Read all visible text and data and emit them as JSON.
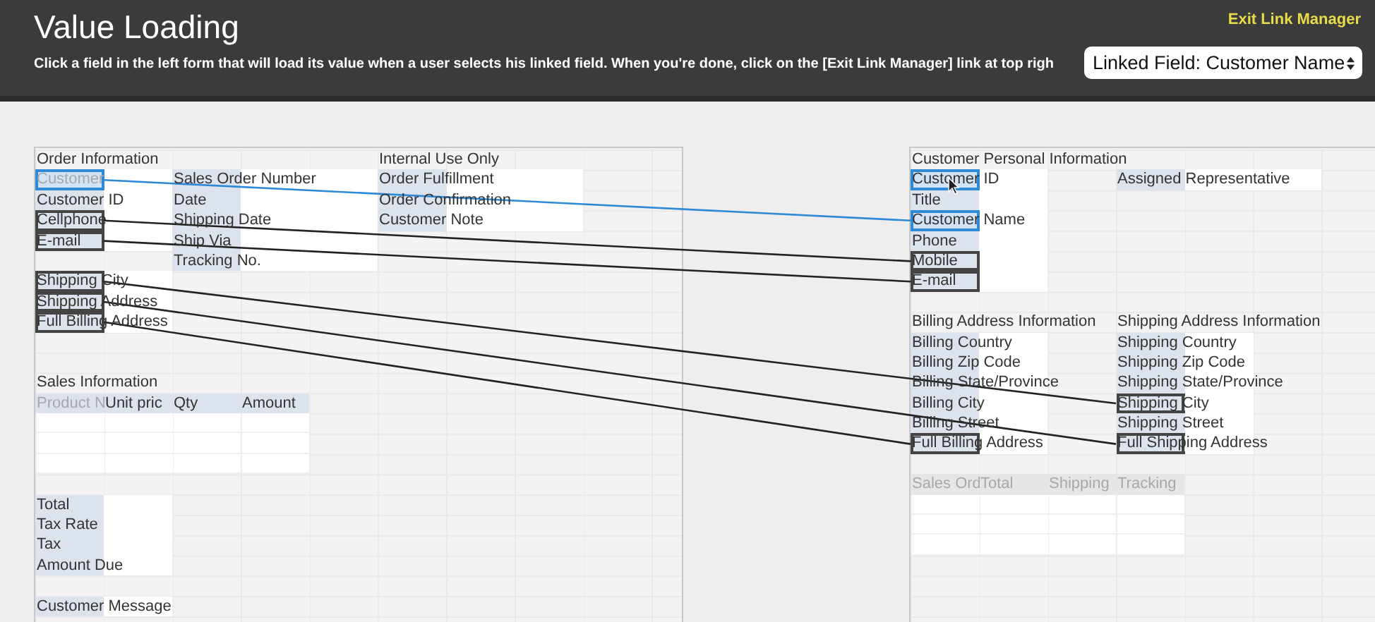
{
  "header": {
    "title": "Value Loading",
    "instructions": "Click a field in the left form that will load its value when a user selects his linked field. When you're done, click on the [Exit Link Manager] link at top righ",
    "exit_link": "Exit Link Manager",
    "linked_field_select": {
      "value": "Linked Field: Customer Name"
    }
  },
  "panels": [
    {
      "cells": [
        {
          "kind": "heading",
          "label": "Order Information"
        },
        {
          "kind": "heading",
          "label": "Internal Use Only"
        },
        {
          "kind": "field",
          "label": "Customer",
          "linked": true,
          "highlighted": true,
          "disabled": true
        },
        {
          "kind": "field",
          "label": "Sales Order Number",
          "linked": false,
          "highlighted": false,
          "disabled": false
        },
        {
          "kind": "field",
          "label": "Order Fulfillment",
          "linked": false,
          "highlighted": false,
          "disabled": false
        },
        {
          "kind": "field",
          "label": "Customer ID",
          "linked": false,
          "highlighted": false,
          "disabled": false
        },
        {
          "kind": "field",
          "label": "Date",
          "linked": false,
          "highlighted": false,
          "disabled": false
        },
        {
          "kind": "field",
          "label": "Order Confirmation",
          "linked": false,
          "highlighted": false,
          "disabled": false
        },
        {
          "kind": "field",
          "label": "Cellphone",
          "linked": true,
          "highlighted": false,
          "disabled": false
        },
        {
          "kind": "field",
          "label": "Shipping Date",
          "linked": false,
          "highlighted": false,
          "disabled": false
        },
        {
          "kind": "field",
          "label": "Customer Note",
          "linked": false,
          "highlighted": false,
          "disabled": false
        },
        {
          "kind": "field",
          "label": "E-mail",
          "linked": true,
          "highlighted": false,
          "disabled": false
        },
        {
          "kind": "field",
          "label": "Ship Via",
          "linked": false,
          "highlighted": false,
          "disabled": false
        },
        {
          "kind": "field",
          "label": "Tracking No.",
          "linked": false,
          "highlighted": false,
          "disabled": false
        },
        {
          "kind": "field",
          "label": "Shipping City",
          "linked": true,
          "highlighted": false,
          "disabled": false
        },
        {
          "kind": "field",
          "label": "Shipping Address",
          "linked": true,
          "highlighted": false,
          "disabled": false
        },
        {
          "kind": "field",
          "label": "Full Billing Address",
          "linked": true,
          "highlighted": false,
          "disabled": false
        },
        {
          "kind": "heading",
          "label": "Sales Information"
        },
        {
          "kind": "column_header",
          "label": "Product N",
          "disabled": true
        },
        {
          "kind": "column_header",
          "label": "Unit pric",
          "disabled": false
        },
        {
          "kind": "column_header",
          "label": "Qty",
          "disabled": false
        },
        {
          "kind": "column_header",
          "label": "Amount",
          "disabled": false
        },
        {
          "kind": "field",
          "label": "Total",
          "linked": false,
          "highlighted": false,
          "disabled": false
        },
        {
          "kind": "field",
          "label": "Tax Rate",
          "linked": false,
          "highlighted": false,
          "disabled": false
        },
        {
          "kind": "field",
          "label": "Tax",
          "linked": false,
          "highlighted": false,
          "disabled": false
        },
        {
          "kind": "field",
          "label": "Amount Due",
          "linked": false,
          "highlighted": false,
          "disabled": false
        },
        {
          "kind": "field",
          "label": "Customer Message",
          "linked": false,
          "highlighted": false,
          "disabled": false
        }
      ]
    },
    {
      "cells": [
        {
          "kind": "heading",
          "label": "Customer Personal Information"
        },
        {
          "kind": "field",
          "label": "Customer ID",
          "linked": false,
          "highlighted": true,
          "disabled": false
        },
        {
          "kind": "field",
          "label": "Assigned Representative",
          "linked": false,
          "highlighted": false,
          "disabled": false
        },
        {
          "kind": "field",
          "label": "Title",
          "linked": false,
          "highlighted": false,
          "disabled": false
        },
        {
          "kind": "field",
          "label": "Customer Name",
          "linked": true,
          "highlighted": true,
          "disabled": false
        },
        {
          "kind": "field",
          "label": "Phone",
          "linked": false,
          "highlighted": false,
          "disabled": false
        },
        {
          "kind": "field",
          "label": "Mobile",
          "linked": true,
          "highlighted": false,
          "disabled": false
        },
        {
          "kind": "field",
          "label": "E-mail",
          "linked": true,
          "highlighted": false,
          "disabled": false
        },
        {
          "kind": "heading",
          "label": "Billing Address Information"
        },
        {
          "kind": "heading",
          "label": "Shipping Address Information"
        },
        {
          "kind": "field",
          "label": "Billing Country",
          "linked": false,
          "highlighted": false,
          "disabled": false
        },
        {
          "kind": "field",
          "label": "Shipping Country",
          "linked": false,
          "highlighted": false,
          "disabled": false
        },
        {
          "kind": "field",
          "label": "Billing Zip Code",
          "linked": false,
          "highlighted": false,
          "disabled": false
        },
        {
          "kind": "field",
          "label": "Shipping Zip Code",
          "linked": false,
          "highlighted": false,
          "disabled": false
        },
        {
          "kind": "field",
          "label": "Billing State/Province",
          "linked": false,
          "highlighted": false,
          "disabled": false
        },
        {
          "kind": "field",
          "label": "Shipping State/Province",
          "linked": false,
          "highlighted": false,
          "disabled": false
        },
        {
          "kind": "field",
          "label": "Billing City",
          "linked": false,
          "highlighted": false,
          "disabled": false
        },
        {
          "kind": "field",
          "label": "Shipping City",
          "linked": true,
          "highlighted": false,
          "disabled": false
        },
        {
          "kind": "field",
          "label": "Billing Street",
          "linked": false,
          "highlighted": false,
          "disabled": false
        },
        {
          "kind": "field",
          "label": "Shipping Street",
          "linked": false,
          "highlighted": false,
          "disabled": false
        },
        {
          "kind": "field",
          "label": "Full Billing Address",
          "linked": true,
          "highlighted": false,
          "disabled": false
        },
        {
          "kind": "field",
          "label": "Full Shipping Address",
          "linked": true,
          "highlighted": false,
          "disabled": false
        },
        {
          "kind": "column_header",
          "label": "Sales Ord",
          "disabled": true
        },
        {
          "kind": "column_header",
          "label": "Total",
          "disabled": true
        },
        {
          "kind": "column_header",
          "label": "Shipping",
          "disabled": true
        },
        {
          "kind": "column_header",
          "label": "Tracking",
          "disabled": true
        }
      ]
    }
  ],
  "links": [
    {
      "selected": true
    },
    {
      "selected": false
    },
    {
      "selected": false
    },
    {
      "selected": false
    },
    {
      "selected": false
    },
    {
      "selected": false
    }
  ]
}
